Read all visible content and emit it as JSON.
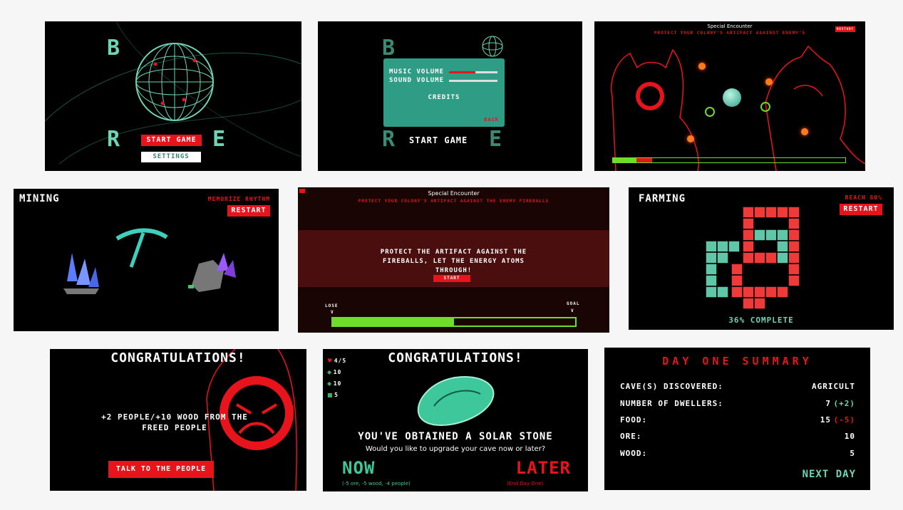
{
  "colors": {
    "red": "#e8141b",
    "teal": "#6fd3b5",
    "green": "#6fdc2a",
    "black": "#000000",
    "bg": "#f6f6f6"
  },
  "menu": {
    "letters": [
      "B",
      "R",
      "E"
    ],
    "start": "START GAME",
    "settings": "SETTINGS",
    "icon": "wireframe-globe-icon"
  },
  "settings": {
    "letters": [
      "B",
      "R",
      "E"
    ],
    "music": "MUSIC VOLUME",
    "sound": "SOUND VOLUME",
    "music_level": 0.55,
    "credits": "CREDITS",
    "back": "BACK",
    "start": "START GAME"
  },
  "encounter": {
    "title": "Special Encounter",
    "subtitle": "PROTECT YOUR COLONY'S ARTIFACT AGAINST ENEMY'S",
    "restart": "RESTART",
    "progress_green": 0.1,
    "progress_red": 0.07
  },
  "mining": {
    "title": "MINING",
    "hint": "MEMORIZE RHYTHM",
    "restart": "RESTART",
    "icons": [
      "blue-crystal-icon",
      "pickaxe-icon",
      "purple-ore-icon"
    ]
  },
  "intro": {
    "title": "Special Encounter",
    "subtitle": "PROTECT YOUR COLONY'S ARTIFACT AGAINST THE ENEMY FIREBALLS",
    "message": "PROTECT THE ARTIFACT AGAINST THE FIREBALLS, LET THE ENERGY ATOMS THROUGH!",
    "start": "START",
    "lose": "LOSE",
    "goal": "GOAL",
    "arrow": "V",
    "progress": 0.5
  },
  "farming": {
    "title": "FARMING",
    "hint": "REACH 80%",
    "restart": "RESTART",
    "progress": "36% COMPLETE"
  },
  "freed": {
    "title": "CONGRATULATIONS!",
    "message": "+2 PEOPLE/+10 WOOD FROM THE FREED PEOPLE",
    "button": "TALK TO THE PEOPLE"
  },
  "stone": {
    "title": "CONGRATULATIONS!",
    "stats": [
      {
        "icon": "heart-icon",
        "value": "4/5"
      },
      {
        "icon": "food-icon",
        "value": "10"
      },
      {
        "icon": "ore-icon",
        "value": "10"
      },
      {
        "icon": "wood-icon",
        "value": "5"
      }
    ],
    "obtained": "YOU'VE OBTAINED A SOLAR STONE",
    "question": "Would you like to upgrade your cave now or later?",
    "now": "NOW",
    "now_cost": "(-5 ore, -5 wood, -4 people)",
    "later": "LATER",
    "later_note": "(End Day One)"
  },
  "summary": {
    "title": "DAY ONE SUMMARY",
    "rows": [
      {
        "label": "CAVE(S) DISCOVERED:",
        "value": "AGRICULT",
        "delta": ""
      },
      {
        "label": "NUMBER OF DWELLERS:",
        "value": "7",
        "delta": "(+2)"
      },
      {
        "label": "FOOD:",
        "value": "15",
        "delta": "(-5)"
      },
      {
        "label": "ORE:",
        "value": "10",
        "delta": ""
      },
      {
        "label": "WOOD:",
        "value": "5",
        "delta": ""
      }
    ],
    "next": "NEXT DAY"
  }
}
